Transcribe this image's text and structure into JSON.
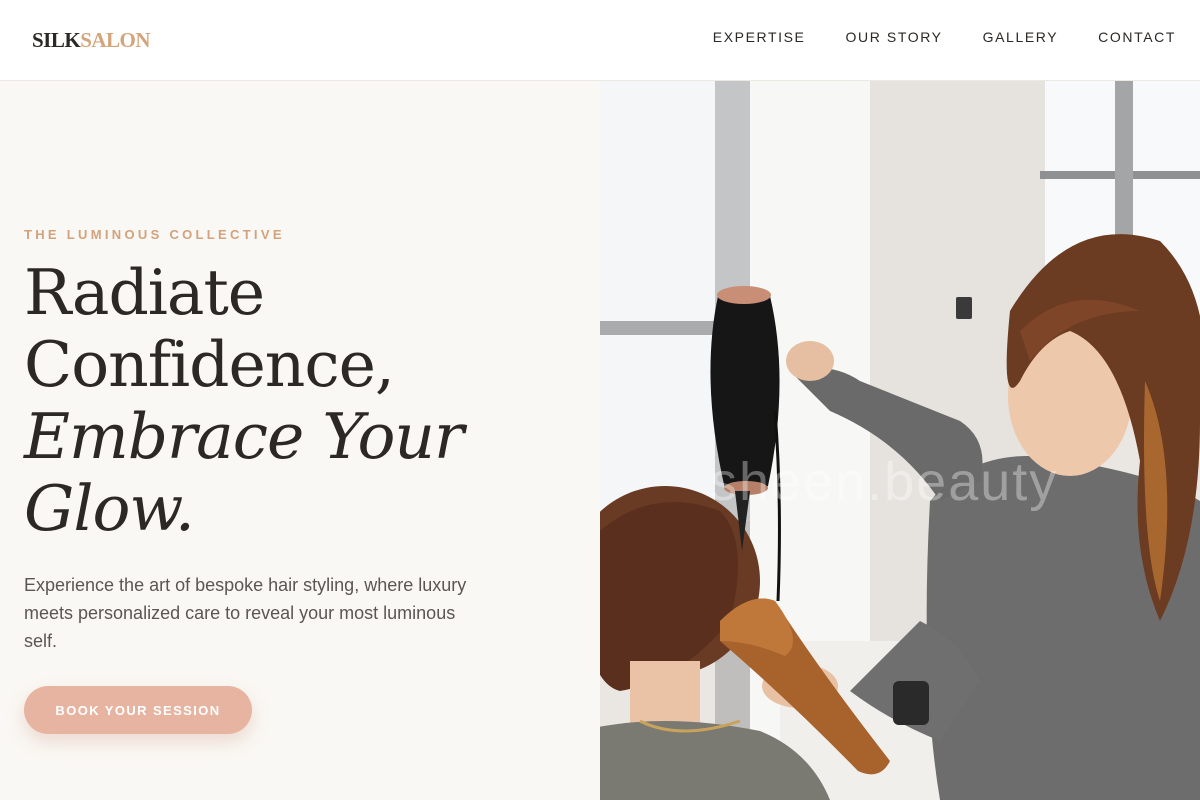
{
  "brand": {
    "name_part1": "SILK",
    "name_part2": "SALON"
  },
  "nav": {
    "items": [
      {
        "label": "EXPERTISE"
      },
      {
        "label": "OUR STORY"
      },
      {
        "label": "GALLERY"
      },
      {
        "label": "CONTACT"
      }
    ]
  },
  "hero": {
    "eyebrow": "THE LUMINOUS COLLECTIVE",
    "headline_line1": "Radiate",
    "headline_line2": "Confidence,",
    "headline_italic_line1": "Embrace Your",
    "headline_italic_line2": "Glow.",
    "subtext": "Experience the art of bespoke hair styling, where luxury meets personalized care to reveal your most luminous self.",
    "cta_label": "BOOK YOUR SESSION",
    "image_watermark": "sheen.beauty"
  },
  "colors": {
    "background": "#faf8f4",
    "accent_gold": "#d4a47a",
    "cta_pink": "#e7b4a2",
    "text_dark": "#2b2825"
  }
}
